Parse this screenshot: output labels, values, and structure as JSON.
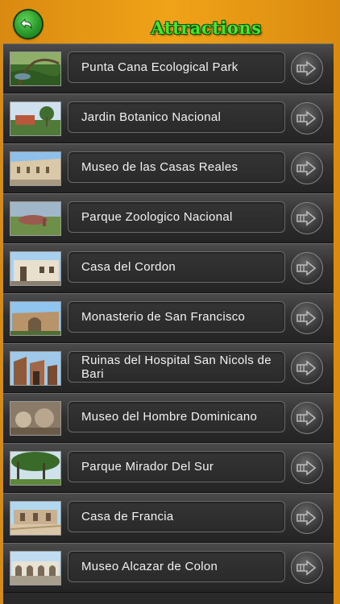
{
  "header": {
    "title": "Attractions",
    "back_icon": "back-arrow-icon"
  },
  "colors": {
    "background": "#f0a318",
    "title": "#46e82e",
    "row_dark": "#2a2a2a"
  },
  "items": [
    {
      "label": "Punta Cana Ecological Park",
      "thumb": "forest"
    },
    {
      "label": "Jardin Botanico Nacional",
      "thumb": "garden"
    },
    {
      "label": "Museo de las Casas Reales",
      "thumb": "building"
    },
    {
      "label": "Parque Zoologico Nacional",
      "thumb": "zoo"
    },
    {
      "label": "Casa del Cordon",
      "thumb": "house"
    },
    {
      "label": "Monasterio de San Francisco",
      "thumb": "ruins"
    },
    {
      "label": "Ruinas del Hospital San Nicols de Bari",
      "thumb": "ruins2"
    },
    {
      "label": "Museo del Hombre Dominicano",
      "thumb": "interior"
    },
    {
      "label": "Parque Mirador Del Sur",
      "thumb": "park"
    },
    {
      "label": "Casa de Francia",
      "thumb": "plaza"
    },
    {
      "label": "Museo Alcazar de Colon",
      "thumb": "palace"
    }
  ]
}
